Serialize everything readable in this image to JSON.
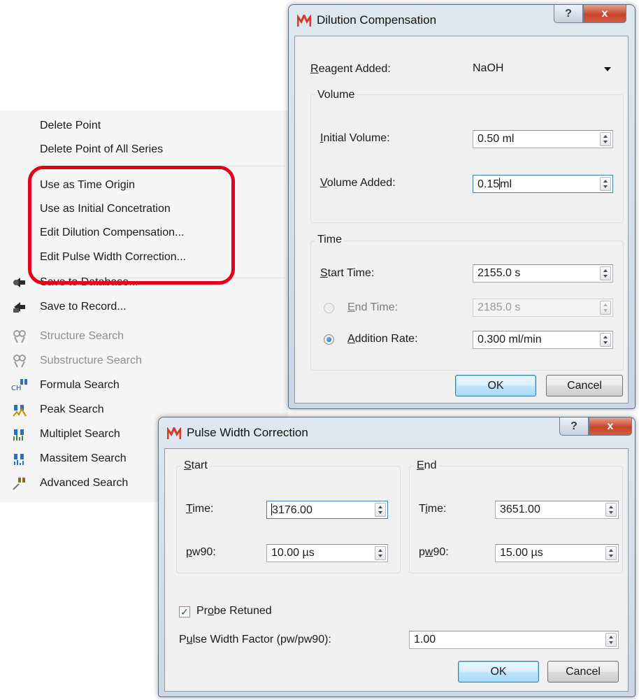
{
  "context_menu": {
    "items": [
      {
        "label": "Delete Point",
        "icon": "",
        "enabled": true
      },
      {
        "label": "Delete Point of All Series",
        "icon": "",
        "enabled": true
      },
      {
        "label": "Use as Time Origin",
        "icon": "",
        "enabled": true
      },
      {
        "label": "Use as Initial Concetration",
        "icon": "",
        "enabled": true
      },
      {
        "label": "Edit Dilution Compensation...",
        "icon": "",
        "enabled": true
      },
      {
        "label": "Edit Pulse Width Correction...",
        "icon": "",
        "enabled": true
      },
      {
        "label": "Save to Database...",
        "icon": "save-to-database-icon",
        "enabled": true
      },
      {
        "label": "Save to Record...",
        "icon": "save-to-record-icon",
        "enabled": true
      },
      {
        "label": "Structure Search",
        "icon": "structure-search-icon",
        "enabled": false
      },
      {
        "label": "Substructure Search",
        "icon": "substructure-search-icon",
        "enabled": false
      },
      {
        "label": "Formula Search",
        "icon": "formula-search-icon",
        "enabled": true
      },
      {
        "label": "Peak Search",
        "icon": "peak-search-icon",
        "enabled": true
      },
      {
        "label": "Multiplet Search",
        "icon": "multiplet-search-icon",
        "enabled": true
      },
      {
        "label": "Massitem Search",
        "icon": "massitem-search-icon",
        "enabled": true
      },
      {
        "label": "Advanced Search",
        "icon": "advanced-search-icon",
        "enabled": true
      }
    ],
    "highlight_color": "#e3001b"
  },
  "dilution_dialog": {
    "title": "Dilution Compensation",
    "help_glyph": "?",
    "close_glyph": "x",
    "reagent_label_first": "R",
    "reagent_label_rest": "eagent Added:",
    "reagent_value": "NaOH",
    "volume_group": "Volume",
    "initial_volume_first": "I",
    "initial_volume_rest": "nitial Volume:",
    "initial_volume_value": "0.50 ml",
    "volume_added_first": "V",
    "volume_added_rest": "olume Added:",
    "volume_added_value_before_caret": "0.15",
    "volume_added_value_after_caret": "ml",
    "time_group": "Time",
    "start_time_first": "S",
    "start_time_rest": "tart Time:",
    "start_time_value": "2155.0 s",
    "end_time_first": "E",
    "end_time_rest": "nd Time:",
    "end_time_value": "2185.0 s",
    "end_time_selected": false,
    "addition_rate_first": "A",
    "addition_rate_rest": "ddition Rate:",
    "addition_rate_value": "0.300 ml/min",
    "addition_rate_selected": true,
    "ok_label": "OK",
    "cancel_label": "Cancel"
  },
  "pulse_dialog": {
    "title": "Pulse Width Correction",
    "help_glyph": "?",
    "close_glyph": "x",
    "start_group_first": "S",
    "start_group_rest": "tart",
    "end_group_first": "E",
    "end_group_rest": "nd",
    "start_time_first": "T",
    "start_time_rest": "ime:",
    "start_time_value": "3176.00",
    "start_pw90_first": "p",
    "start_pw90_rest": "w90:",
    "start_pw90_value": "10.00 µs",
    "end_time_pre": "T",
    "end_time_u": "i",
    "end_time_post": "me:",
    "end_time_value": "3651.00",
    "end_pw90_pre": "p",
    "end_pw90_u": "w",
    "end_pw90_post": "90:",
    "end_pw90_value": "15.00 µs",
    "probe_pre": "Pr",
    "probe_u": "o",
    "probe_post": "be Retuned",
    "probe_checked": true,
    "factor_pre": "P",
    "factor_u": "u",
    "factor_post": "lse Width Factor (pw/pw90):",
    "factor_value": "1.00",
    "ok_label": "OK",
    "cancel_label": "Cancel"
  }
}
